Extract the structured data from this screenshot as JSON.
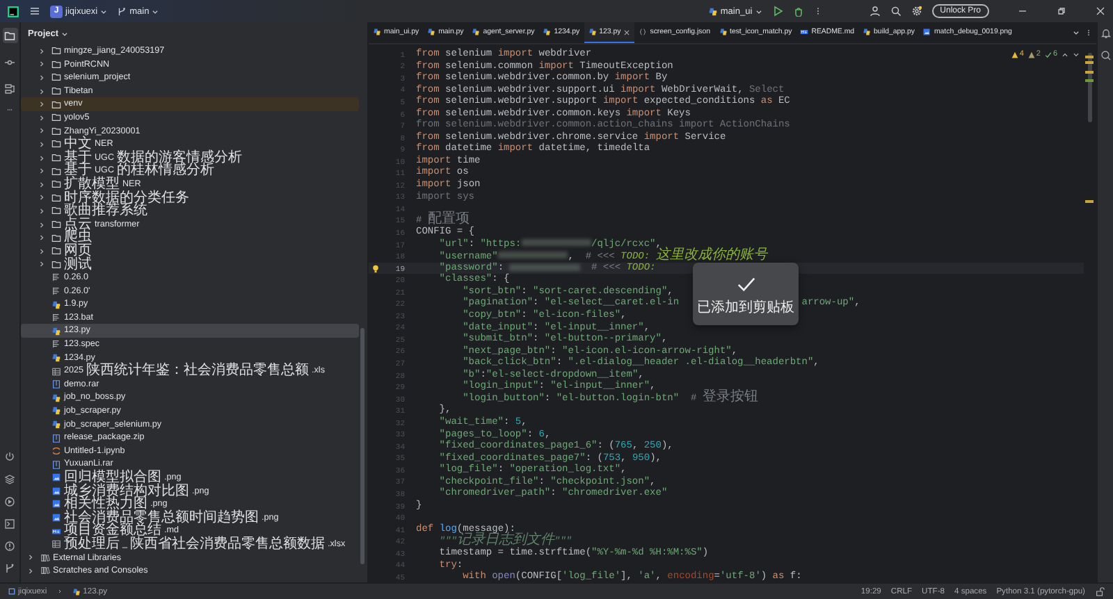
{
  "title_bar": {
    "project_badge": "J",
    "project": "jiqixuexi",
    "branch": "main",
    "run_config": "main_ui",
    "unlock_button": "Unlock Pro"
  },
  "tool_windows": [
    {
      "selected": true
    },
    {
      "selected": false
    },
    {
      "selected": false
    }
  ],
  "project_panel": {
    "title": "Project",
    "files": [
      {
        "label": "mingze_jiang_240053197",
        "kind": "folder",
        "expanded": false,
        "selected": false,
        "excluded": false
      },
      {
        "label": "PointRCNN",
        "kind": "folder",
        "expanded": false,
        "selected": false,
        "excluded": false
      },
      {
        "label": "selenium_project",
        "kind": "folder",
        "expanded": false,
        "selected": false,
        "excluded": false
      },
      {
        "label": "Tibetan",
        "kind": "folder",
        "expanded": false,
        "selected": false,
        "excluded": false
      },
      {
        "label": "venv",
        "kind": "folder",
        "expanded": false,
        "selected": false,
        "excluded": true
      },
      {
        "label": "yolov5",
        "kind": "folder",
        "expanded": false,
        "selected": false,
        "excluded": false
      },
      {
        "label": "ZhangYi_20230001",
        "kind": "folder",
        "expanded": false,
        "selected": false,
        "excluded": false
      },
      {
        "label": "中文NER",
        "kind": "folder",
        "expanded": false,
        "selected": false,
        "excluded": false
      },
      {
        "label": "基于UGC数据的游客情感分析",
        "kind": "folder",
        "expanded": false,
        "selected": false,
        "excluded": false
      },
      {
        "label": "基于UGC的桂林情感分析",
        "kind": "folder",
        "expanded": false,
        "selected": false,
        "excluded": false
      },
      {
        "label": "扩散模型NER",
        "kind": "folder",
        "expanded": false,
        "selected": false,
        "excluded": false
      },
      {
        "label": "时序数据的分类任务",
        "kind": "folder",
        "expanded": false,
        "selected": false,
        "excluded": false
      },
      {
        "label": "歌曲推荐系统",
        "kind": "folder",
        "expanded": false,
        "selected": false,
        "excluded": false
      },
      {
        "label": "点云transformer",
        "kind": "folder",
        "expanded": false,
        "selected": false,
        "excluded": false
      },
      {
        "label": "爬虫",
        "kind": "folder",
        "expanded": false,
        "selected": false,
        "excluded": false
      },
      {
        "label": "网页",
        "kind": "folder",
        "expanded": false,
        "selected": false,
        "excluded": false
      },
      {
        "label": "测试",
        "kind": "folder",
        "expanded": false,
        "selected": false,
        "excluded": false
      },
      {
        "label": "0.26.0",
        "kind": "text",
        "selected": false,
        "excluded": false
      },
      {
        "label": "0.26.0'",
        "kind": "text",
        "selected": false,
        "excluded": false
      },
      {
        "label": "1.9.py",
        "kind": "python",
        "selected": false,
        "excluded": false
      },
      {
        "label": "123.bat",
        "kind": "text",
        "selected": false,
        "excluded": false
      },
      {
        "label": "123.py",
        "kind": "python",
        "selected": true,
        "excluded": false
      },
      {
        "label": "123.spec",
        "kind": "text",
        "selected": false,
        "excluded": false
      },
      {
        "label": "1234.py",
        "kind": "python",
        "selected": false,
        "excluded": false
      },
      {
        "label": "2025陕西统计年鉴：社会消费品零售总额.xls",
        "kind": "table",
        "selected": false,
        "excluded": false
      },
      {
        "label": "demo.rar",
        "kind": "archive",
        "selected": false,
        "excluded": false
      },
      {
        "label": "job_no_boss.py",
        "kind": "python",
        "selected": false,
        "excluded": false
      },
      {
        "label": "job_scraper.py",
        "kind": "python",
        "selected": false,
        "excluded": false
      },
      {
        "label": "job_scraper_selenium.py",
        "kind": "python",
        "selected": false,
        "excluded": false
      },
      {
        "label": "release_package.zip",
        "kind": "archive",
        "selected": false,
        "excluded": false
      },
      {
        "label": "Untitled-1.ipynb",
        "kind": "notebook",
        "selected": false,
        "excluded": false
      },
      {
        "label": "YuxuanLi.rar",
        "kind": "archive",
        "selected": false,
        "excluded": false
      },
      {
        "label": "回归模型拟合图.png",
        "kind": "image",
        "selected": false,
        "excluded": false
      },
      {
        "label": "城乡消费结构对比图.png",
        "kind": "image",
        "selected": false,
        "excluded": false
      },
      {
        "label": "相关性热力图.png",
        "kind": "image",
        "selected": false,
        "excluded": false
      },
      {
        "label": "社会消费品零售总额时间趋势图.png",
        "kind": "image",
        "selected": false,
        "excluded": false
      },
      {
        "label": "项目资金额总结.md",
        "kind": "markdown",
        "selected": false,
        "excluded": false
      },
      {
        "label": "预处理后_陕西省社会消费品零售总额数据.xlsx",
        "kind": "table",
        "selected": false,
        "excluded": false
      }
    ],
    "libraries": [
      {
        "label": "External Libraries",
        "expanded": false
      },
      {
        "label": "Scratches and Consoles",
        "expanded": false
      }
    ]
  },
  "tabs": [
    {
      "label": "main_ui.py",
      "kind": "python",
      "selected": false
    },
    {
      "label": "main.py",
      "kind": "python",
      "selected": false
    },
    {
      "label": "agent_server.py",
      "kind": "python",
      "selected": false
    },
    {
      "label": "1234.py",
      "kind": "python",
      "selected": false
    },
    {
      "label": "123.py",
      "kind": "python",
      "selected": true
    },
    {
      "label": "screen_config.json",
      "kind": "json",
      "selected": false
    },
    {
      "label": "test_icon_match.py",
      "kind": "python",
      "selected": false
    },
    {
      "label": "README.md",
      "kind": "markdown",
      "selected": false
    },
    {
      "label": "build_app.py",
      "kind": "python",
      "selected": false
    },
    {
      "label": "match_debug_0019.png",
      "kind": "image",
      "selected": false
    }
  ],
  "inspections": {
    "warnings": "4",
    "weak_warnings": "2",
    "ok": "6"
  },
  "editor": {
    "lines": [
      {
        "n": "1",
        "current": false,
        "tokens": [
          {
            "kind": "kw",
            "text": "from"
          },
          {
            "kind": "plain",
            "text": " selenium "
          },
          {
            "kind": "kw",
            "text": "import"
          },
          {
            "kind": "plain",
            "text": " webdriver"
          }
        ]
      },
      {
        "n": "2",
        "current": false,
        "tokens": [
          {
            "kind": "kw",
            "text": "from"
          },
          {
            "kind": "plain",
            "text": " selenium.common "
          },
          {
            "kind": "kw",
            "text": "import"
          },
          {
            "kind": "plain",
            "text": " TimeoutException"
          }
        ]
      },
      {
        "n": "3",
        "current": false,
        "tokens": [
          {
            "kind": "kw",
            "text": "from"
          },
          {
            "kind": "plain",
            "text": " selenium.webdriver.common.by "
          },
          {
            "kind": "kw",
            "text": "import"
          },
          {
            "kind": "plain",
            "text": " By"
          }
        ]
      },
      {
        "n": "4",
        "current": false,
        "tokens": [
          {
            "kind": "kw",
            "text": "from"
          },
          {
            "kind": "plain",
            "text": " selenium.webdriver.support.ui "
          },
          {
            "kind": "kw",
            "text": "import"
          },
          {
            "kind": "plain",
            "text": " WebDriverWait, "
          },
          {
            "kind": "dim",
            "text": "Select"
          }
        ]
      },
      {
        "n": "5",
        "current": false,
        "tokens": [
          {
            "kind": "kw",
            "text": "from"
          },
          {
            "kind": "plain",
            "text": " selenium.webdriver.support "
          },
          {
            "kind": "kw",
            "text": "import"
          },
          {
            "kind": "plain",
            "text": " expected_conditions "
          },
          {
            "kind": "kw",
            "text": "as"
          },
          {
            "kind": "plain",
            "text": " EC"
          }
        ]
      },
      {
        "n": "6",
        "current": false,
        "tokens": [
          {
            "kind": "kw",
            "text": "from"
          },
          {
            "kind": "plain",
            "text": " selenium.webdriver.common.keys "
          },
          {
            "kind": "kw",
            "text": "import"
          },
          {
            "kind": "plain",
            "text": " Keys"
          }
        ]
      },
      {
        "n": "7",
        "current": false,
        "tokens": [
          {
            "kind": "dim",
            "text": "from selenium.webdriver.common.action_chains import ActionChains"
          }
        ]
      },
      {
        "n": "8",
        "current": false,
        "tokens": [
          {
            "kind": "kw",
            "text": "from"
          },
          {
            "kind": "plain",
            "text": " selenium.webdriver.chrome.service "
          },
          {
            "kind": "kw",
            "text": "import"
          },
          {
            "kind": "plain",
            "text": " Service"
          }
        ]
      },
      {
        "n": "9",
        "current": false,
        "tokens": [
          {
            "kind": "kw",
            "text": "from"
          },
          {
            "kind": "plain",
            "text": " datetime "
          },
          {
            "kind": "kw",
            "text": "import"
          },
          {
            "kind": "plain",
            "text": " datetime, timedelta"
          }
        ]
      },
      {
        "n": "10",
        "current": false,
        "tokens": [
          {
            "kind": "kw",
            "text": "import"
          },
          {
            "kind": "plain",
            "text": " time"
          }
        ]
      },
      {
        "n": "11",
        "current": false,
        "tokens": [
          {
            "kind": "kw",
            "text": "import"
          },
          {
            "kind": "plain",
            "text": " os"
          }
        ]
      },
      {
        "n": "12",
        "current": false,
        "tokens": [
          {
            "kind": "kw",
            "text": "import"
          },
          {
            "kind": "plain",
            "text": " json"
          }
        ]
      },
      {
        "n": "13",
        "current": false,
        "tokens": [
          {
            "kind": "dim",
            "text": "import sys"
          }
        ]
      },
      {
        "n": "14",
        "current": false
      },
      {
        "n": "15",
        "current": false,
        "tokens": [
          {
            "kind": "com",
            "text": "# 配置项"
          }
        ]
      },
      {
        "n": "16",
        "current": false,
        "tokens": [
          {
            "kind": "plain",
            "text": "CONFIG = {"
          }
        ]
      },
      {
        "n": "17",
        "current": false,
        "tokens": [
          {
            "kind": "str",
            "text": "    \"url\""
          },
          {
            "kind": "plain",
            "text": ": "
          },
          {
            "kind": "str",
            "text": "\"https:"
          },
          {
            "kind": "blur"
          },
          {
            "kind": "str",
            "text": "/qljc/rcxc\""
          },
          {
            "kind": "plain",
            "text": ","
          }
        ]
      },
      {
        "n": "18",
        "current": false,
        "tokens": [
          {
            "kind": "str",
            "text": "    \"username\""
          },
          {
            "kind": "blur"
          },
          {
            "kind": "plain",
            "text": ",  "
          },
          {
            "kind": "com",
            "text": "# <<< "
          },
          {
            "kind": "todo",
            "text": "TODO: 这里改成你的账号"
          }
        ]
      },
      {
        "n": "19",
        "current": true,
        "tokens": [
          {
            "kind": "str",
            "text": "    \"password\""
          },
          {
            "kind": "plain",
            "text": ": "
          },
          {
            "kind": "blur"
          },
          {
            "kind": "com",
            "text": "  # <<< "
          },
          {
            "kind": "todo",
            "text": "TODO:"
          }
        ]
      },
      {
        "n": "20",
        "current": false,
        "tokens": [
          {
            "kind": "str",
            "text": "    \"classes\""
          },
          {
            "kind": "plain",
            "text": ": {"
          }
        ]
      },
      {
        "n": "21",
        "current": false,
        "tokens": [
          {
            "kind": "str",
            "text": "        \"sort_btn\""
          },
          {
            "kind": "plain",
            "text": ": "
          },
          {
            "kind": "str",
            "text": "\"sort-caret.descending\""
          },
          {
            "kind": "plain",
            "text": ","
          }
        ]
      },
      {
        "n": "22",
        "current": false,
        "tokens": [
          {
            "kind": "str",
            "text": "        \"pagination\""
          },
          {
            "kind": "plain",
            "text": ": "
          },
          {
            "kind": "str",
            "text": "\"el-select__caret.el-in"
          },
          {
            "kind": "gap"
          },
          {
            "kind": "str",
            "text": "arrow-up\""
          },
          {
            "kind": "plain",
            "text": ","
          }
        ]
      },
      {
        "n": "23",
        "current": false,
        "tokens": [
          {
            "kind": "str",
            "text": "        \"copy_btn\""
          },
          {
            "kind": "plain",
            "text": ": "
          },
          {
            "kind": "str",
            "text": "\"el-icon-files\""
          },
          {
            "kind": "plain",
            "text": ","
          }
        ]
      },
      {
        "n": "24",
        "current": false,
        "tokens": [
          {
            "kind": "str",
            "text": "        \"date_input\""
          },
          {
            "kind": "plain",
            "text": ": "
          },
          {
            "kind": "str",
            "text": "\"el-input__inner\""
          },
          {
            "kind": "plain",
            "text": ","
          }
        ]
      },
      {
        "n": "25",
        "current": false,
        "tokens": [
          {
            "kind": "str",
            "text": "        \"submit_btn\""
          },
          {
            "kind": "plain",
            "text": ": "
          },
          {
            "kind": "str",
            "text": "\"el-button--primary\""
          },
          {
            "kind": "plain",
            "text": ","
          }
        ]
      },
      {
        "n": "26",
        "current": false,
        "tokens": [
          {
            "kind": "str",
            "text": "        \"next_page_btn\""
          },
          {
            "kind": "plain",
            "text": ": "
          },
          {
            "kind": "str",
            "text": "\"el-icon.el-icon-arrow-right\""
          },
          {
            "kind": "plain",
            "text": ","
          }
        ]
      },
      {
        "n": "27",
        "current": false,
        "tokens": [
          {
            "kind": "str",
            "text": "        \"back_click_btn\""
          },
          {
            "kind": "plain",
            "text": ": "
          },
          {
            "kind": "str",
            "text": "\".el-dialog__header .el-dialog__headerbtn\""
          },
          {
            "kind": "plain",
            "text": ","
          }
        ]
      },
      {
        "n": "28",
        "current": false,
        "tokens": [
          {
            "kind": "str",
            "text": "        \"b\""
          },
          {
            "kind": "plain",
            "text": ":"
          },
          {
            "kind": "str",
            "text": "\"el-select-dropdown__item\""
          },
          {
            "kind": "plain",
            "text": ","
          }
        ]
      },
      {
        "n": "29",
        "current": false,
        "tokens": [
          {
            "kind": "str",
            "text": "        \"login_input\""
          },
          {
            "kind": "plain",
            "text": ": "
          },
          {
            "kind": "str",
            "text": "\"el-input__inner\""
          },
          {
            "kind": "plain",
            "text": ","
          }
        ]
      },
      {
        "n": "30",
        "current": false,
        "tokens": [
          {
            "kind": "str",
            "text": "        \"login_button\""
          },
          {
            "kind": "plain",
            "text": ": "
          },
          {
            "kind": "str",
            "text": "\"el-button.login-btn\""
          },
          {
            "kind": "com",
            "text": "  # 登录按钮"
          }
        ]
      },
      {
        "n": "31",
        "current": false,
        "tokens": [
          {
            "kind": "plain",
            "text": "    },"
          }
        ]
      },
      {
        "n": "32",
        "current": false,
        "tokens": [
          {
            "kind": "str",
            "text": "    \"wait_time\""
          },
          {
            "kind": "plain",
            "text": ": "
          },
          {
            "kind": "num",
            "text": "5"
          },
          {
            "kind": "plain",
            "text": ","
          }
        ]
      },
      {
        "n": "33",
        "current": false,
        "tokens": [
          {
            "kind": "str",
            "text": "    \"pages_to_loop\""
          },
          {
            "kind": "plain",
            "text": ": "
          },
          {
            "kind": "num",
            "text": "6"
          },
          {
            "kind": "plain",
            "text": ","
          }
        ]
      },
      {
        "n": "34",
        "current": false,
        "tokens": [
          {
            "kind": "str",
            "text": "    \"fixed_coordinates_page1_6\""
          },
          {
            "kind": "plain",
            "text": ": ("
          },
          {
            "kind": "num",
            "text": "765"
          },
          {
            "kind": "plain",
            "text": ", "
          },
          {
            "kind": "num",
            "text": "250"
          },
          {
            "kind": "plain",
            "text": "),"
          }
        ]
      },
      {
        "n": "35",
        "current": false,
        "tokens": [
          {
            "kind": "str",
            "text": "    \"fixed_coordinates_page7\""
          },
          {
            "kind": "plain",
            "text": ": ("
          },
          {
            "kind": "num",
            "text": "753"
          },
          {
            "kind": "plain",
            "text": ", "
          },
          {
            "kind": "num",
            "text": "950"
          },
          {
            "kind": "plain",
            "text": "),"
          }
        ]
      },
      {
        "n": "36",
        "current": false,
        "tokens": [
          {
            "kind": "str",
            "text": "    \"log_file\""
          },
          {
            "kind": "plain",
            "text": ": "
          },
          {
            "kind": "str",
            "text": "\"operation_log.txt\""
          },
          {
            "kind": "plain",
            "text": ","
          }
        ]
      },
      {
        "n": "37",
        "current": false,
        "tokens": [
          {
            "kind": "str",
            "text": "    \"checkpoint_file\""
          },
          {
            "kind": "plain",
            "text": ": "
          },
          {
            "kind": "str",
            "text": "\"checkpoint.json\""
          },
          {
            "kind": "plain",
            "text": ","
          }
        ]
      },
      {
        "n": "38",
        "current": false,
        "tokens": [
          {
            "kind": "str",
            "text": "    \"chromedriver_path\""
          },
          {
            "kind": "plain",
            "text": ": "
          },
          {
            "kind": "str",
            "text": "\"chromedriver.exe\""
          }
        ]
      },
      {
        "n": "39",
        "current": false,
        "tokens": [
          {
            "kind": "plain",
            "text": "}"
          }
        ]
      },
      {
        "n": "40",
        "current": false
      },
      {
        "n": "41",
        "current": false,
        "tokens": [
          {
            "kind": "kw",
            "text": "def "
          },
          {
            "kind": "fn",
            "text": "log"
          },
          {
            "kind": "plain",
            "text": "(message):"
          }
        ]
      },
      {
        "n": "42",
        "current": false,
        "tokens": [
          {
            "kind": "doc",
            "text": "    \"\"\"记录日志到文件\"\"\""
          }
        ]
      },
      {
        "n": "43",
        "current": false,
        "tokens": [
          {
            "kind": "plain",
            "text": "    timestamp = time.strftime("
          },
          {
            "kind": "str",
            "text": "\"%Y-%m-%d %H:%M:%S\""
          },
          {
            "kind": "plain",
            "text": ")"
          }
        ]
      },
      {
        "n": "44",
        "current": false,
        "tokens": [
          {
            "kind": "kw",
            "text": "    try"
          },
          {
            "kind": "plain",
            "text": ":"
          }
        ]
      },
      {
        "n": "45",
        "current": false,
        "tokens": [
          {
            "kind": "kw",
            "text": "        with "
          },
          {
            "kind": "builtin",
            "text": "open"
          },
          {
            "kind": "plain",
            "text": "(CONFIG["
          },
          {
            "kind": "str",
            "text": "'log_file'"
          },
          {
            "kind": "plain",
            "text": "], "
          },
          {
            "kind": "str",
            "text": "'a'"
          },
          {
            "kind": "plain",
            "text": ", "
          },
          {
            "kind": "param",
            "text": "encoding"
          },
          {
            "kind": "plain",
            "text": "="
          },
          {
            "kind": "str",
            "text": "'utf-8'"
          },
          {
            "kind": "plain",
            "text": ") "
          },
          {
            "kind": "kw",
            "text": "as"
          },
          {
            "kind": "plain",
            "text": " f:"
          }
        ]
      }
    ]
  },
  "toast": {
    "message": "已添加到剪贴板"
  },
  "status_bar": {
    "breadcrumbs": [
      "jiqixuexi",
      "123.py"
    ],
    "position": "19:29",
    "line_separator": "CRLF",
    "encoding": "UTF-8",
    "indent": "4 spaces",
    "interpreter": "Python 3.1 (pytorch-gpu)"
  }
}
